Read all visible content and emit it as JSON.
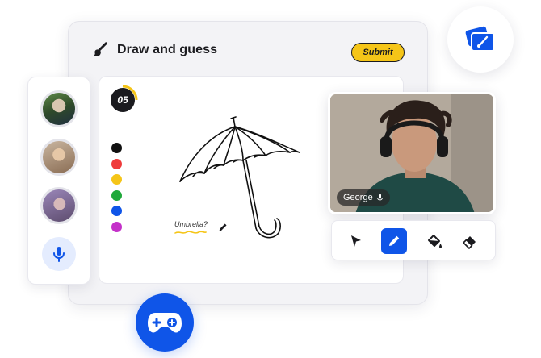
{
  "app": {
    "title": "Draw and guess",
    "submit_label": "Submit",
    "accent_color": "#0f55e8",
    "submit_color": "#f5c518"
  },
  "timer": {
    "value": "05"
  },
  "palette": {
    "colors": [
      "#111111",
      "#ef3b3b",
      "#f5c518",
      "#1fa83a",
      "#0f55e8",
      "#c431c9"
    ]
  },
  "canvas": {
    "guess_text": "Umbrella?",
    "drawing": "umbrella"
  },
  "players": {
    "avatars": [
      "avatar-1",
      "avatar-2",
      "avatar-3"
    ],
    "mic_icon": "microphone-icon"
  },
  "video": {
    "name": "George",
    "status_icon": "microphone-icon"
  },
  "tools": {
    "items": [
      "select-arrow-icon",
      "pencil-icon",
      "fill-bucket-icon",
      "eraser-icon"
    ],
    "active": "pencil-icon"
  },
  "floating": {
    "gallery_icon": "cards-brush-icon",
    "game_icon": "gamepad-plus-icon"
  }
}
